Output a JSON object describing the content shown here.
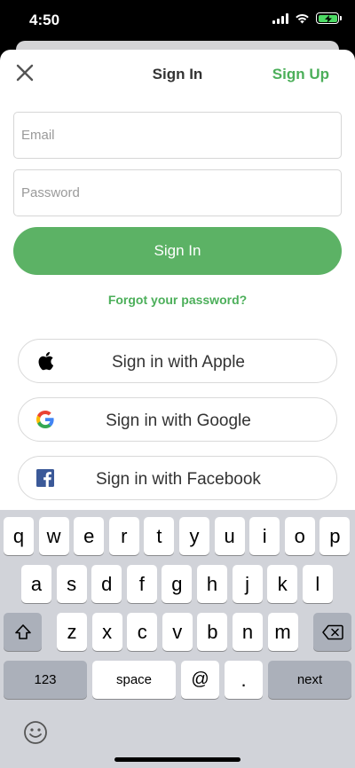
{
  "status_bar": {
    "time": "4:50"
  },
  "nav": {
    "title": "Sign In",
    "signup_label": "Sign Up"
  },
  "form": {
    "email_placeholder": "Email",
    "password_placeholder": "Password",
    "signin_label": "Sign In",
    "forgot_label": "Forgot your password?"
  },
  "social": {
    "apple_label": "Sign in with Apple",
    "google_label": "Sign in with Google",
    "facebook_label": "Sign in with Facebook"
  },
  "keyboard": {
    "row1": [
      "q",
      "w",
      "e",
      "r",
      "t",
      "y",
      "u",
      "i",
      "o",
      "p"
    ],
    "row2": [
      "a",
      "s",
      "d",
      "f",
      "g",
      "h",
      "j",
      "k",
      "l"
    ],
    "row3": [
      "z",
      "x",
      "c",
      "v",
      "b",
      "n",
      "m"
    ],
    "numbers_label": "123",
    "space_label": "space",
    "at_label": "@",
    "dot_label": ".",
    "next_label": "next"
  },
  "colors": {
    "accent": "#5cb265",
    "link": "#4caf5a",
    "battery": "#4cd964"
  },
  "icons": [
    "close-icon",
    "apple-logo-icon",
    "google-logo-icon",
    "facebook-logo-icon",
    "shift-icon",
    "backspace-icon",
    "emoji-icon",
    "wifi-icon",
    "battery-icon",
    "signal-icon"
  ]
}
